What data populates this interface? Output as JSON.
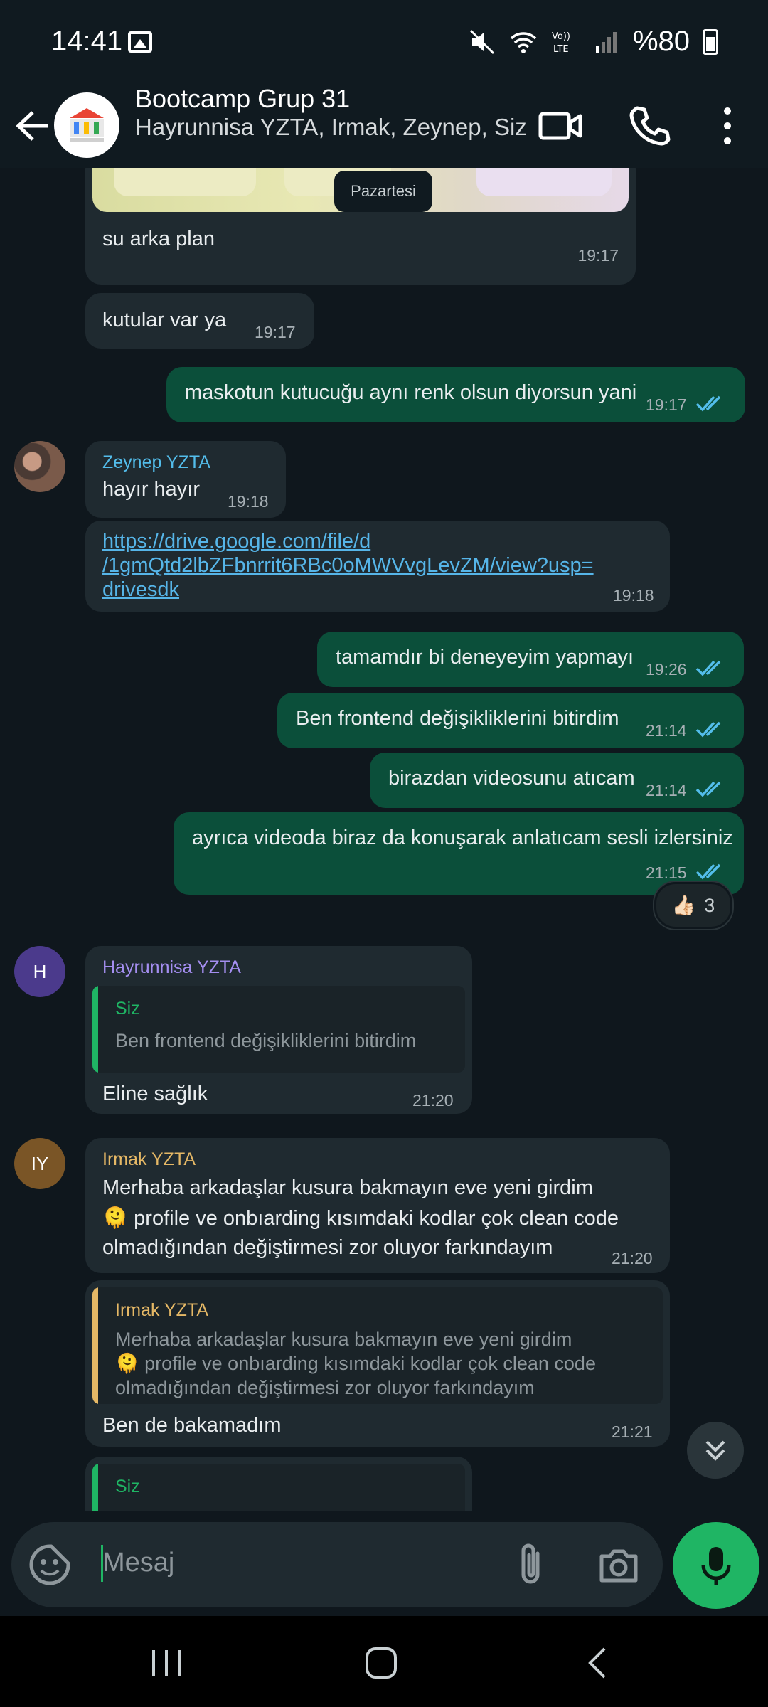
{
  "status_bar": {
    "time": "14:41",
    "battery": "%80"
  },
  "header": {
    "title": "Bootcamp Grup 31",
    "members": "Hayrunnisa YZTA, Irmak, Zeynep, Siz"
  },
  "date_chip": "Pazartesi",
  "messages": [
    {
      "text": "su arka plan",
      "time": "19:17"
    },
    {
      "text": "kutular var ya",
      "time": "19:17"
    },
    {
      "text": "maskotun kutucuğu aynı renk olsun diyorsun yani",
      "time": "19:17"
    },
    {
      "sender": "Zeynep YZTA",
      "text": "hayır hayır",
      "time": "19:18"
    },
    {
      "link": [
        "https://drive.google.com/file/d",
        "/1gmQtd2lbZFbnrrit6RBc0oMWVvgLevZM/view?usp=",
        "drivesdk"
      ],
      "time": "19:18"
    },
    {
      "text": "tamamdır bi deneyeyim yapmayı",
      "time": "19:26"
    },
    {
      "text": "Ben frontend değişikliklerini bitirdim",
      "time": "21:14"
    },
    {
      "text": "birazdan videosunu atıcam",
      "time": "21:14"
    },
    {
      "text": "ayrıca videoda biraz da konuşarak anlatıcam sesli izlersiniz",
      "time": "21:15",
      "reaction": {
        "emoji": "👍🏻",
        "count": "3"
      }
    },
    {
      "sender": "Hayrunnisa YZTA",
      "avatar": "H",
      "quote_name": "Siz",
      "quote_text": "Ben frontend değişikliklerini bitirdim",
      "text": "Eline sağlık",
      "time": "21:20"
    },
    {
      "sender": "Irmak YZTA",
      "avatar": "IY",
      "lines": [
        "Merhaba arkadaşlar kusura bakmayın eve yeni girdim",
        "🫠 profile ve onbıarding kısımdaki kodlar çok clean code",
        "olmadığından değiştirmesi zor oluyor farkındayım"
      ],
      "time": "21:20"
    },
    {
      "quote_name": "Irmak YZTA",
      "quote_lines": [
        "Merhaba arkadaşlar kusura bakmayın eve yeni girdim",
        "🫠 profile ve onbıarding kısımdaki kodlar çok clean code",
        "olmadığından değiştirmesi zor oluyor farkındayım"
      ],
      "text": "Ben de bakamadım",
      "time": "21:21"
    },
    {
      "quote_name": "Siz"
    }
  ],
  "composer": {
    "placeholder": "Mesaj"
  },
  "colors": {
    "outgoing": "#0b4f3a",
    "incoming": "#1f2a30",
    "accent": "#1fb564",
    "tick": "#53bdeb"
  }
}
